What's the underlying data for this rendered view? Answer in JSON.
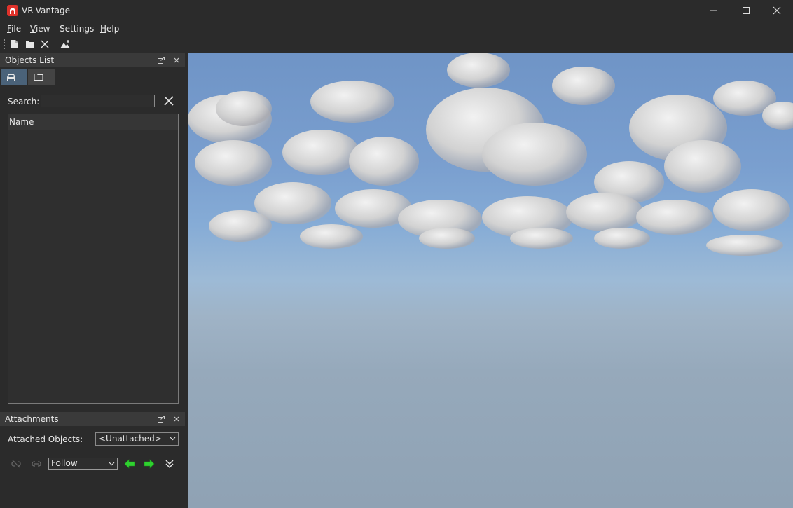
{
  "app": {
    "title": "VR-Vantage"
  },
  "menu": [
    {
      "label_u": "F",
      "label_rest": "ile"
    },
    {
      "label_u": "V",
      "label_rest": "iew"
    },
    {
      "label_u": "",
      "label_rest": "Settings"
    },
    {
      "label_u": "H",
      "label_rest": "elp"
    }
  ],
  "toolbar": {
    "icons": [
      "new-file-icon",
      "open-folder-icon",
      "close-icon",
      "terrain-icon"
    ]
  },
  "objects_panel": {
    "title": "Objects List",
    "tabs": [
      "car-icon",
      "folder-icon"
    ],
    "search_label": "Search:",
    "search_value": "",
    "column_header": "Name"
  },
  "attachments_panel": {
    "title": "Attachments",
    "attached_label": "Attached Objects:",
    "attached_value": "<Unattached>",
    "mode_value": "Follow"
  },
  "colors": {
    "arrow_green": "#2fd12f",
    "tab_active": "#4a6279",
    "logo_red": "#e0322b"
  }
}
